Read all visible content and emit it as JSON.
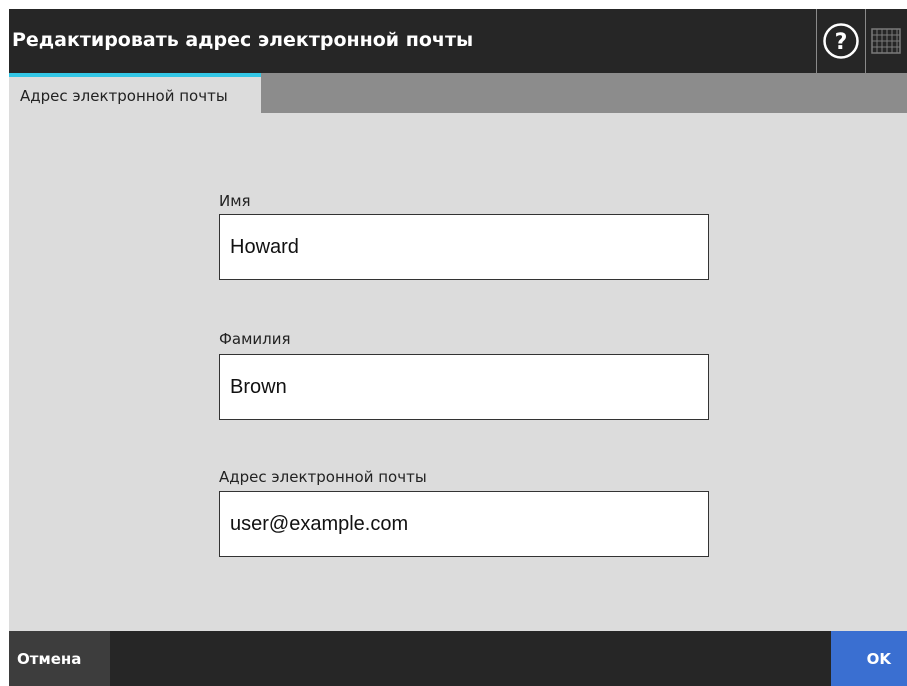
{
  "window": {
    "title": "Редактировать адрес электронной почты"
  },
  "header": {
    "help_icon": "help-circle-question-icon",
    "keyboard_icon": "keyboard-icon"
  },
  "tabs": [
    {
      "label": "Адрес электронной почты",
      "active": true
    }
  ],
  "form": {
    "first_name_label": "Имя",
    "first_name_value": "Howard",
    "last_name_label": "Фамилия",
    "last_name_value": "Brown",
    "email_label": "Адрес электронной почты",
    "email_value": "user@example.com"
  },
  "footer": {
    "cancel_label": "Отмена",
    "ok_label": "OK"
  },
  "colors": {
    "titlebar": "#262626",
    "content_bg": "#dcdcdc",
    "tab_accent": "#33c7e6",
    "ok_button": "#3a6fd1",
    "cancel_button": "#3d3d3d"
  }
}
